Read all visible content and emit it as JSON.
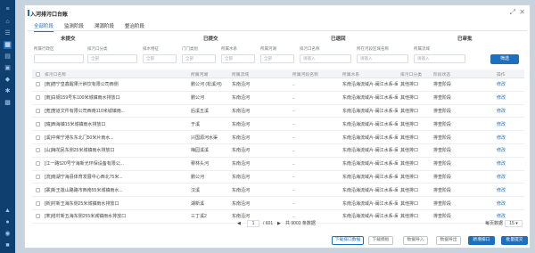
{
  "modal": {
    "title": "入河排污口台账",
    "ctrl_expand": "⤢",
    "ctrl_close": "✕"
  },
  "tabs": [
    "全部阶段",
    "监测阶段",
    "溯源阶段",
    "整治阶段"
  ],
  "stages": [
    "未提交",
    "已提交",
    "已退回",
    "已审批"
  ],
  "filters": {
    "labels": [
      "所属行政区",
      "排污口分类",
      "排水特征",
      "门门类别",
      "所属水系",
      "所属河湖",
      "排污口名称",
      "所在河段区域名称",
      "所属流域"
    ],
    "placeholders": [
      "",
      "全部",
      "全部",
      "全部",
      "全部",
      "全部",
      "请输入",
      "请输入",
      "请输入"
    ],
    "search_label": "筛选"
  },
  "table": {
    "headers": [
      "排污口名称",
      "所属河湖",
      "所属流域",
      "所属河段名称",
      "所属水系",
      "排污口分类",
      "阶段状态",
      "操作"
    ],
    "rows": [
      {
        "name": "[南]德宁皇鑫醒果汁醉饮有限公司西侧",
        "river": "鹏公河 (松溪河)",
        "basin": "东南沿河",
        "section": "..",
        "system": "东南沿海流域片-闽江水系-闽江",
        "cat": "其他排口",
        "stage": "排查阶段",
        "op": "修改"
      },
      {
        "name": "[南]白钢159号东100米城镇雨水排放口",
        "river": "鹏公河",
        "basin": "东南沿河",
        "section": "..",
        "system": "东南沿海流域片-闽江水系-闽江",
        "cat": "其他排口",
        "stage": "排查阶段",
        "op": "修改"
      },
      {
        "name": "[宽]宽道文件有限公司西南110米城镇雨...",
        "river": "后溪五溪",
        "basin": "东南沿河",
        "section": "..",
        "system": "东南沿海流域片-闽江水系-闽江",
        "cat": "其他排口",
        "stage": "排查阶段",
        "op": "修改"
      },
      {
        "name": "[瑞]西海镇15米城镇雨水排放口",
        "river": "于溪",
        "basin": "东南沿河",
        "section": "..",
        "system": "东南沿海流域片-闽江水系-闽江",
        "cat": "其他排口",
        "stage": "排查阶段",
        "op": "修改"
      },
      {
        "name": "[溪]中荣宁港东东北门50米片雨水...",
        "river": "兴国源河水渠",
        "basin": "东南沿河",
        "section": "..",
        "system": "东南沿海流域片-闽江水系-闽江",
        "cat": "其他排口",
        "stage": "排查阶段",
        "op": "修改"
      },
      {
        "name": "[山]梅花民东侧25米城镇雨水排放口",
        "river": "梅园溪溪",
        "basin": "东南沿河",
        "section": "..",
        "system": "东南沿海流域片-闽江水系-闽江",
        "cat": "其他排口",
        "stage": "排查阶段",
        "op": "修改"
      },
      {
        "name": "[江一路520号宁海新光环保设备有限公...",
        "river": "穆林头河",
        "basin": "东南沿河",
        "section": "..",
        "system": "东南沿海流域片-闽江水系-闽江",
        "cat": "其他排口",
        "stage": "排查阶段",
        "op": "修改"
      },
      {
        "name": "[流]南湖宁海县体育发展中心西北75米...",
        "river": "鹏公河",
        "basin": "东南沿河",
        "section": "..",
        "system": "东南沿海流域片-闽江水系-闽江",
        "cat": "其他排口",
        "stage": "排查阶段",
        "op": "修改"
      },
      {
        "name": "[寨]新王莲山路路市西南55米城镇雨水...",
        "river": "汉溪",
        "basin": "东南沿河",
        "section": "..",
        "system": "东南沿海流域片-闽江水系-闽江",
        "cat": "其他排口",
        "stage": "排查阶段",
        "op": "修改"
      },
      {
        "name": "[新]村新王海东侧25米城镇雨水排放口",
        "river": "湖新溪",
        "basin": "东南沿河",
        "section": "..",
        "system": "东南沿海流域片-闽江水系-闽江",
        "cat": "其他排口",
        "stage": "排查阶段",
        "op": "修改"
      },
      {
        "name": "[苯]塔村新五海东侧255米城镇雨水排放口",
        "river": "三丁溪2",
        "basin": "东南沿河",
        "section": "..",
        "system": "东南沿海流域片-闽江水系-闽江",
        "cat": "其他排口",
        "stage": "排查阶段",
        "op": "修改"
      }
    ]
  },
  "pager": {
    "prev": "◀",
    "page": "1",
    "total_pages": "/ 601",
    "next": "▶",
    "total_records": "共 9003 条数据",
    "page_size_label": "每页数据",
    "page_size": "15 ▾"
  },
  "buttons": [
    "下载排口数据",
    "下载模板",
    "数据导入",
    "数据导出",
    "新增排口",
    "批量提交"
  ],
  "sidebar_icons": [
    "menu-icon",
    "home-icon",
    "list-icon",
    "map-icon",
    "chart-icon",
    "file-icon",
    "water-icon",
    "gear-icon",
    "grid-icon",
    "book-icon",
    "user-icon",
    "bell-icon",
    "layers-icon"
  ]
}
